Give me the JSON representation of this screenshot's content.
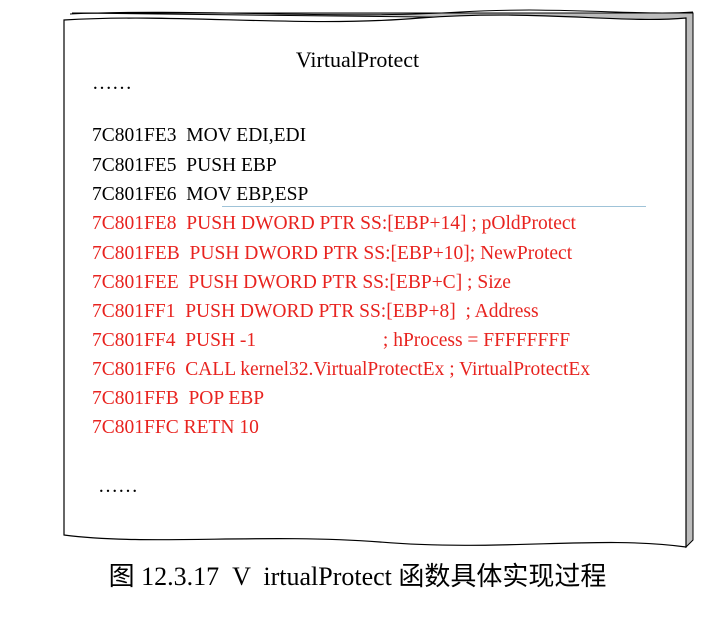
{
  "diagram": {
    "title": "VirtualProtect",
    "ellipsis_top": "……",
    "ellipsis_bottom": "……",
    "lines": [
      {
        "text": "7C801FE3  MOV EDI,EDI",
        "color": "black"
      },
      {
        "text": "7C801FE5  PUSH EBP",
        "color": "black"
      },
      {
        "text": "7C801FE6  MOV EBP,ESP",
        "color": "black"
      },
      {
        "text": "7C801FE8  PUSH DWORD PTR SS:[EBP+14] ; pOldProtect",
        "color": "red"
      },
      {
        "text": "7C801FEB  PUSH DWORD PTR SS:[EBP+10]; NewProtect",
        "color": "red"
      },
      {
        "text": "7C801FEE  PUSH DWORD PTR SS:[EBP+C] ; Size",
        "color": "red"
      },
      {
        "text": "7C801FF1  PUSH DWORD PTR SS:[EBP+8]  ; Address",
        "color": "red"
      },
      {
        "text": "7C801FF4  PUSH -1                          ; hProcess = FFFFFFFF",
        "color": "red"
      },
      {
        "text": "7C801FF6  CALL kernel32.VirtualProtectEx ; VirtualProtectEx",
        "color": "red"
      },
      {
        "text": "7C801FFB  POP EBP",
        "color": "red"
      },
      {
        "text": "7C801FFC RETN 10",
        "color": "red"
      }
    ]
  },
  "caption": "图 12.3.17  V  irtualProtect 函数具体实现过程",
  "colors": {
    "red_text": "#e8231f",
    "black_text": "#000000",
    "separator": "#9fc3d8"
  }
}
